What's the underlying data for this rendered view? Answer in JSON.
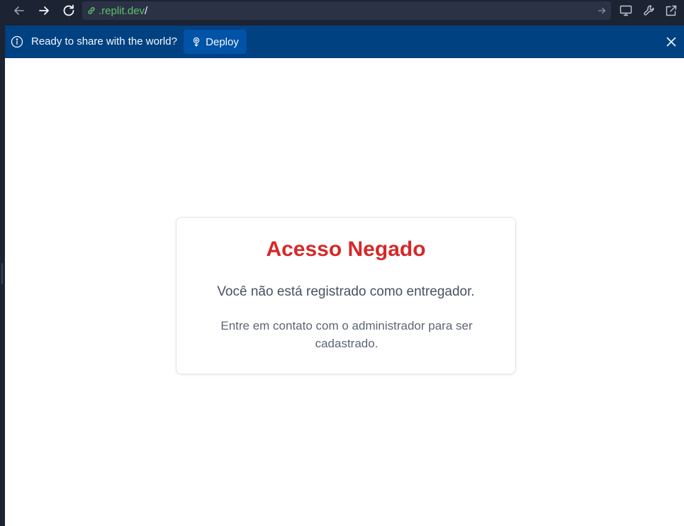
{
  "browser": {
    "url_domain": ".replit.dev",
    "url_path": "/",
    "icons": {
      "back": "arrow-left-icon",
      "forward": "arrow-right-icon",
      "reload": "reload-icon",
      "link": "link-icon",
      "go": "arrow-right-small-icon",
      "devices": "monitor-icon",
      "devtools": "wrench-icon",
      "open_new_tab": "external-link-icon"
    }
  },
  "banner": {
    "message": "Ready to share with the world?",
    "deploy_label": "Deploy",
    "background_color": "#004182",
    "button_color": "#0053a6"
  },
  "page": {
    "title": "Acesso Negado",
    "message": "Você não está registrado como entregador.",
    "submessage": "Entre em contato com o administrador para ser cadastrado.",
    "title_color": "#d62828"
  }
}
